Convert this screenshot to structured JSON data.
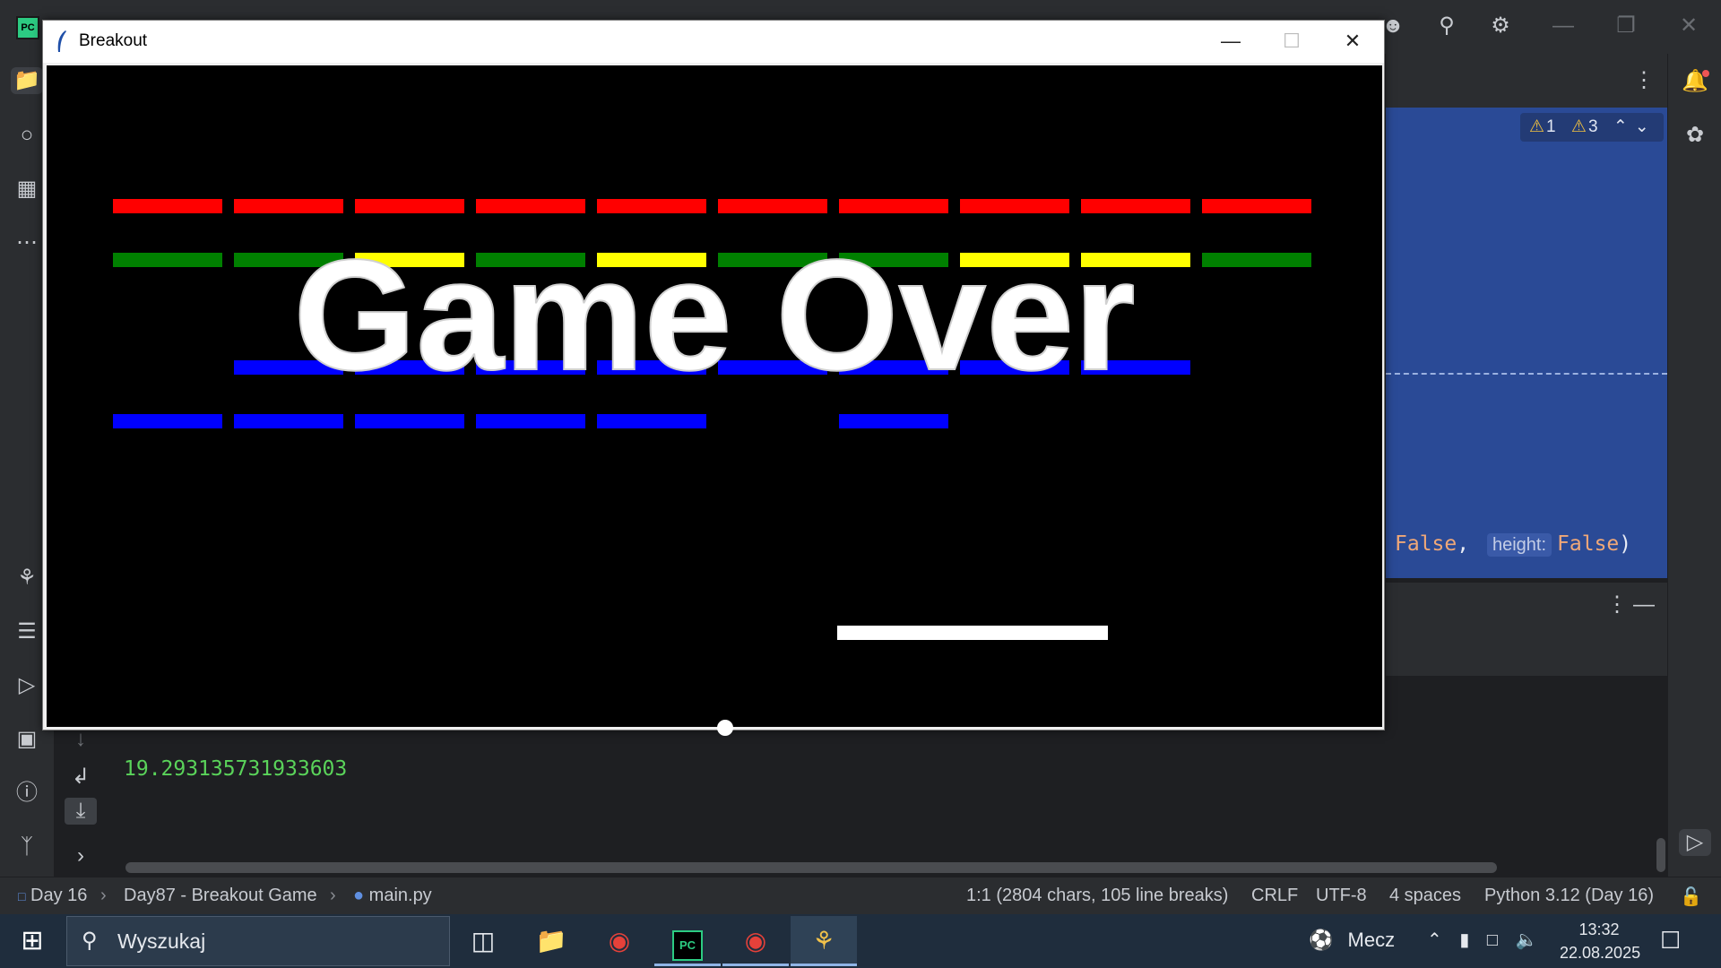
{
  "game_window": {
    "title": "Breakout",
    "overlay_text": "Game Over",
    "brick_rows": [
      [
        "#ff0000",
        "#ff0000",
        "#ff0000",
        "#ff0000",
        "#ff0000",
        "#ff0000",
        "#ff0000",
        "#ff0000",
        "#ff0000",
        "#ff0000"
      ],
      [
        "#008000",
        "#008000",
        "#ffff00",
        "#008000",
        "#ffff00",
        "#008000",
        "#008000",
        "#ffff00",
        "#ffff00",
        "#008000"
      ],
      [
        null,
        "#0000ff",
        "#0000ff",
        "#0000ff",
        "#0000ff",
        "#0000ff",
        "#0000ff",
        "#0000ff",
        "#0000ff",
        null
      ],
      [
        "#0000ff",
        "#0000ff",
        "#0000ff",
        "#0000ff",
        "#0000ff",
        null,
        "#0000ff",
        null,
        null,
        null
      ]
    ],
    "controls": {
      "minimize": "minimize",
      "maximize": "maximize",
      "close": "close"
    }
  },
  "ide": {
    "inspection": {
      "errors": "1",
      "warnings": "3"
    },
    "code_fragment": {
      "value1": "False",
      "hint": "height:",
      "value2": "False"
    },
    "console_output": "19.293135731933603",
    "breadcrumb": {
      "project": "Day 16",
      "folder": "Day87 - Breakout Game",
      "file": "main.py"
    },
    "status": {
      "position": "1:1 (2804 chars, 105 line breaks)",
      "line_sep": "CRLF",
      "encoding": "UTF-8",
      "indent": "4 spaces",
      "interpreter": "Python 3.12 (Day 16)"
    }
  },
  "taskbar": {
    "search_placeholder": "Wyszukaj",
    "weather_text": "Mecz",
    "time": "13:32",
    "date": "22.08.2025"
  },
  "colors": {
    "brick_red": "#ff0000",
    "brick_green": "#008000",
    "brick_yellow": "#ffff00",
    "brick_blue": "#0000ff",
    "console_green": "#5ad35a"
  }
}
